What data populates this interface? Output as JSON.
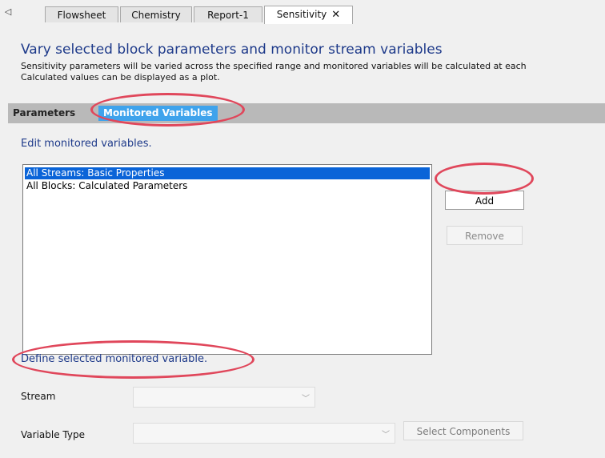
{
  "tabs": [
    {
      "label": "Flowsheet"
    },
    {
      "label": "Chemistry"
    },
    {
      "label": "Report-1"
    },
    {
      "label": "Sensitivity",
      "close": "✕"
    }
  ],
  "nav_arrow": "◁",
  "heading": "Vary selected block parameters and monitor stream variables",
  "description": [
    "Sensitivity parameters will be varied across the specified range and monitored variables will be calculated at each",
    "Calculated values can be displayed as a plot."
  ],
  "subtabs": {
    "parameters": "Parameters",
    "monitored": "Monitored Variables"
  },
  "edit_label": "Edit monitored variables.",
  "monitored_list": [
    {
      "label": "All Streams: Basic Properties",
      "selected": true
    },
    {
      "label": "All Blocks: Calculated Parameters",
      "selected": false
    }
  ],
  "buttons": {
    "add": "Add",
    "remove": "Remove",
    "select_components": "Select Components"
  },
  "define_label": "Define selected monitored variable.",
  "fields": {
    "stream_label": "Stream",
    "stream_value": "",
    "variable_type_label": "Variable Type",
    "variable_type_value": ""
  },
  "icons": {
    "chevron": "﹀"
  },
  "colors": {
    "heading": "#1e3a8a",
    "selection": "#0a64d8",
    "active_subtab": "#3fa3ec",
    "annotation": "#e0475b"
  }
}
